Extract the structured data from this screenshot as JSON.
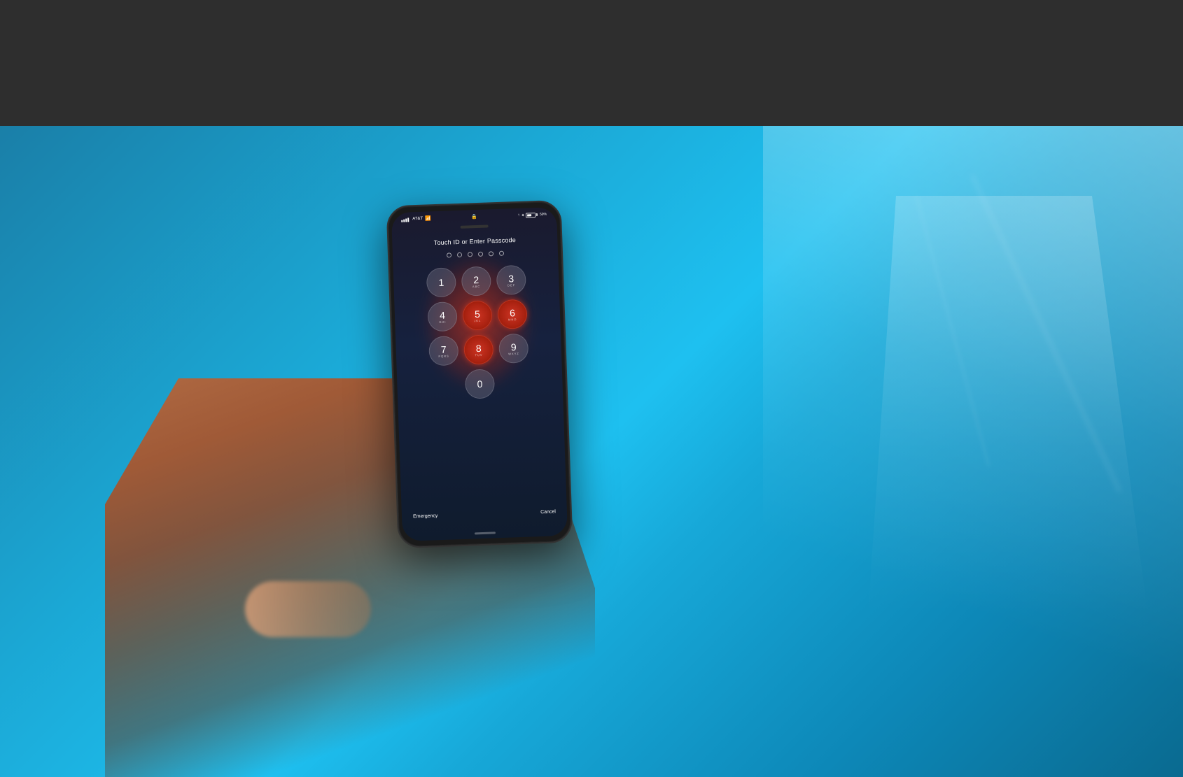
{
  "background": {
    "top_color": "#2e2e2e",
    "table_color": "#1a8ab0"
  },
  "phone": {
    "status_bar": {
      "carrier": "AT&T",
      "wifi_icon": "wifi",
      "lock_icon": "lock",
      "location_icon": "location",
      "bluetooth_icon": "bluetooth",
      "battery_percent": "59%"
    },
    "screen": {
      "title": "Touch ID or Enter Passcode",
      "dots": [
        {
          "filled": false
        },
        {
          "filled": false
        },
        {
          "filled": false
        },
        {
          "filled": false
        },
        {
          "filled": false
        },
        {
          "filled": false
        }
      ],
      "keypad": [
        {
          "row": [
            {
              "number": "1",
              "letters": "",
              "style": "normal"
            },
            {
              "number": "2",
              "letters": "ABC",
              "style": "normal"
            },
            {
              "number": "3",
              "letters": "DEF",
              "style": "normal"
            }
          ]
        },
        {
          "row": [
            {
              "number": "4",
              "letters": "GHI",
              "style": "normal"
            },
            {
              "number": "5",
              "letters": "JKL",
              "style": "red"
            },
            {
              "number": "6",
              "letters": "MNO",
              "style": "red"
            }
          ]
        },
        {
          "row": [
            {
              "number": "7",
              "letters": "PQRS",
              "style": "normal"
            },
            {
              "number": "8",
              "letters": "TUV",
              "style": "red"
            },
            {
              "number": "9",
              "letters": "WXYZ",
              "style": "normal"
            }
          ]
        },
        {
          "row": [
            {
              "number": "0",
              "letters": "",
              "style": "normal"
            }
          ]
        }
      ],
      "bottom_buttons": {
        "left": "Emergency",
        "right": "Cancel"
      }
    }
  }
}
